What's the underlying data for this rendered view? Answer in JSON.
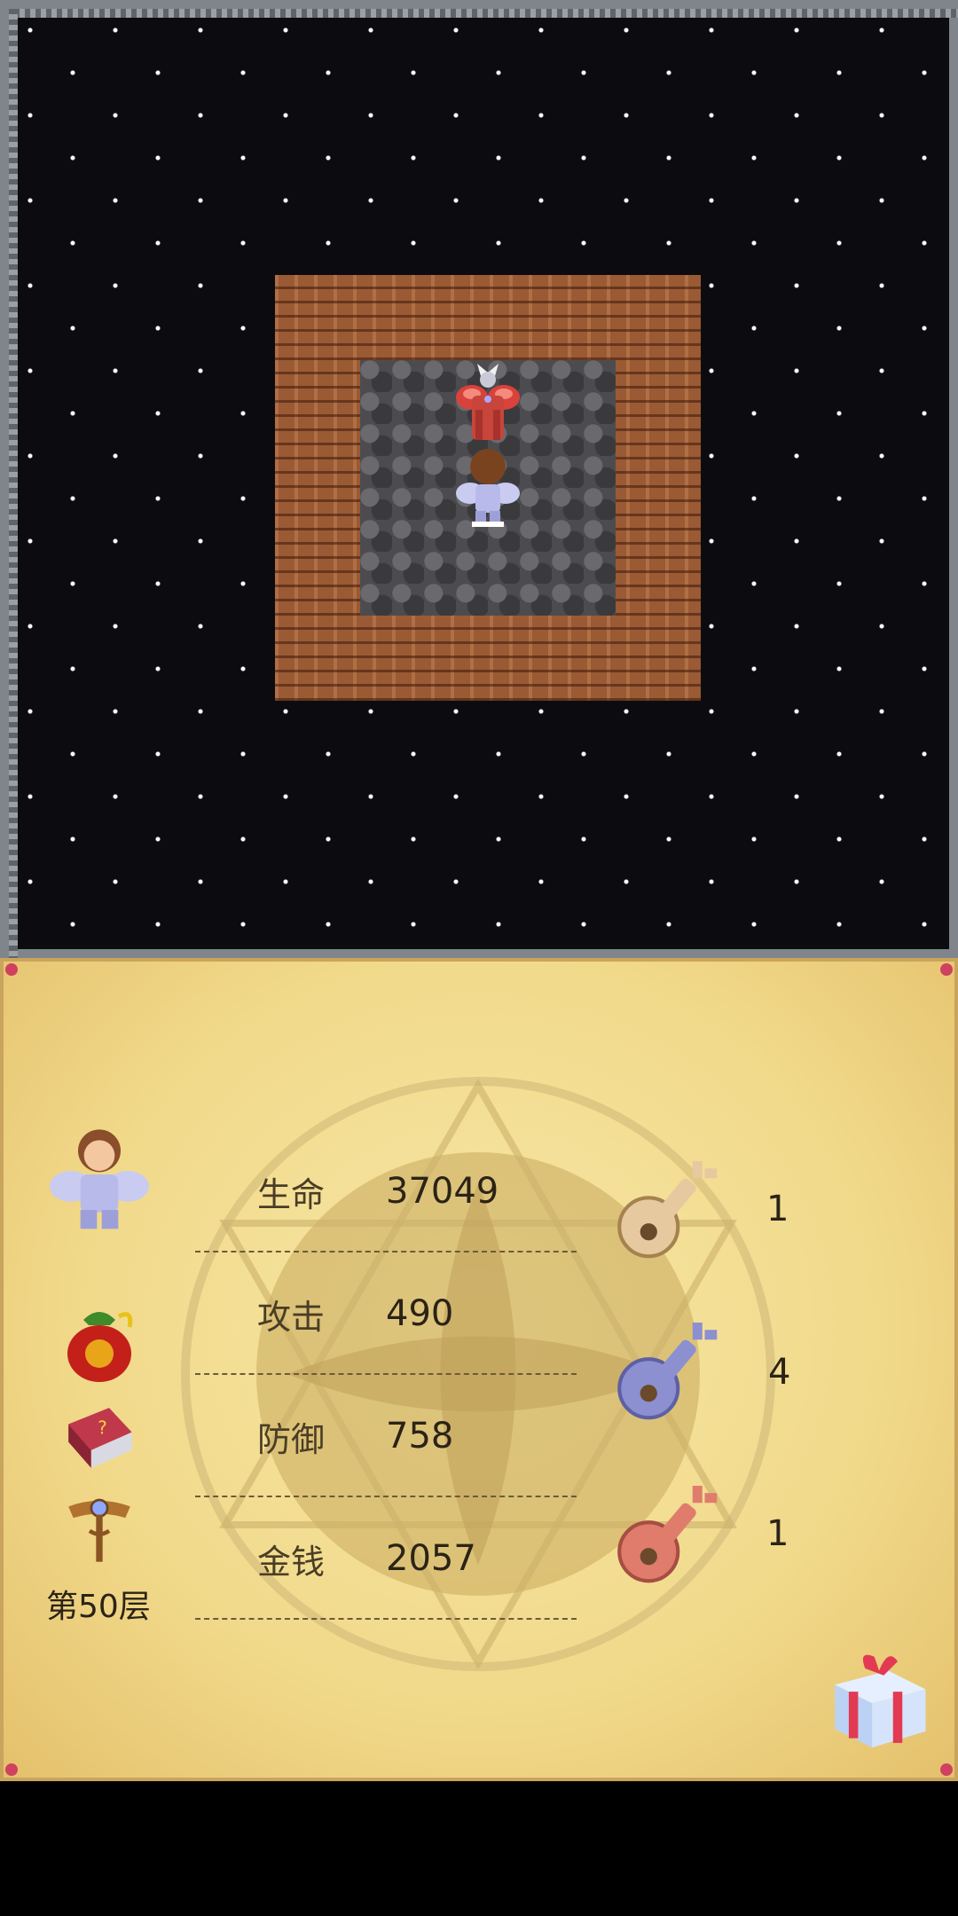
{
  "status": {
    "hp_label": "生命",
    "hp_value": "37049",
    "attack_label": "攻击",
    "attack_value": "490",
    "defense_label": "防御",
    "defense_value": "758",
    "gold_label": "金钱",
    "gold_value": "2057",
    "floor": "第50层"
  },
  "keys": {
    "yellow": "1",
    "blue": "4",
    "red": "1"
  },
  "icons": {
    "hero": "hero-portrait-icon",
    "bag": "lucky-bag-icon",
    "book": "monster-book-icon",
    "fly": "floor-fly-staff-icon",
    "gift": "gift-box-icon",
    "yellow_key": "yellow-key-icon",
    "blue_key": "blue-key-icon",
    "red_key": "red-key-icon"
  },
  "colors": {
    "panel": "#f1d98a",
    "wall": "#9a5a34",
    "floor": "#4c4c50",
    "yellow_key": "#e7c9a0",
    "blue_key": "#8c8fd0",
    "red_key": "#e07c6c"
  }
}
